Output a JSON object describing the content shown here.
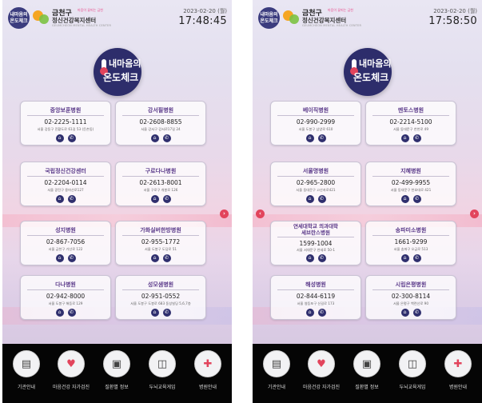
{
  "header": {
    "logo_badge": "내마음의 온도체크",
    "center_name": "금천구",
    "center_sub": "마음이 꽃피는 금천",
    "center_full": "정신건강복지센터",
    "center_eng": "GEUMCHEON MENTAL HEALTH CENTER"
  },
  "emblem": {
    "line1": "내마음의",
    "line2": "온도체크"
  },
  "screens": [
    {
      "date": "2023-02-20 (월)",
      "time": "17:48:45",
      "hospitals": [
        {
          "name": "중앙보훈병원",
          "phone": "02-2225-1111",
          "address": "서울 강동구 진황도로 61길 53 (둔촌동)"
        },
        {
          "name": "강서필병원",
          "phone": "02-2608-8855",
          "address": "서울 강서구 강서로17길 24"
        },
        {
          "name": "국립정신건강센터",
          "phone": "02-2204-0114",
          "address": "서울 광진구 용마산로127"
        },
        {
          "name": "구로다나병원",
          "phone": "02-2613-8001",
          "address": "서울 구로구 개봉로 126"
        },
        {
          "name": "성지병원",
          "phone": "02-867-7056",
          "address": "서울 금천구 가산로 122"
        },
        {
          "name": "가화실버한방병원",
          "phone": "02-955-1772",
          "address": "서울 도봉구 도당로 51"
        },
        {
          "name": "다나병원",
          "phone": "02-942-8000",
          "address": "서울 도봉구 해등로 129"
        },
        {
          "name": "성모샘병원",
          "phone": "02-951-0552",
          "address": "서울 도봉구 도봉로 683 동성빌딩 5,6,7층"
        }
      ]
    },
    {
      "date": "2023-02-20 (월)",
      "time": "17:58:50",
      "hospitals": [
        {
          "name": "베이직병원",
          "phone": "02-990-2999",
          "address": "서울 도봉구 삼양로 610"
        },
        {
          "name": "멘토스병원",
          "phone": "02-2214-5100",
          "address": "서울 동대문구 천천로 49"
        },
        {
          "name": "서울명병원",
          "phone": "02-965-2800",
          "address": "서울 동대문구 고산자로421"
        },
        {
          "name": "지혜병원",
          "phone": "02-499-9955",
          "address": "서울 동대문구 천호대로 421"
        },
        {
          "name": "연세대학교 의과대학 세브란스병원",
          "name1": "연세대학교 의과대학",
          "name2": "세브란스병원",
          "phone": "1599-1004",
          "address": "서울 서대문구 연세로 50-1"
        },
        {
          "name": "송파미소병원",
          "phone": "1661-9299",
          "address": "서울 송파구 오금로 513"
        },
        {
          "name": "해성병원",
          "phone": "02-844-6119",
          "address": "서울 영등포구 신길로 173"
        },
        {
          "name": "시립은평병원",
          "phone": "02-300-8114",
          "address": "서울 은평구 백련산로 90"
        }
      ]
    }
  ],
  "nav": [
    {
      "label": "기관안내",
      "icon": "book-icon"
    },
    {
      "label": "마음건강 자가검진",
      "icon": "heart-pulse-icon"
    },
    {
      "label": "질환별 정보",
      "icon": "clipboard-icon"
    },
    {
      "label": "두뇌교육게임",
      "icon": "gamepad-icon"
    },
    {
      "label": "병원안내",
      "icon": "hospital-icon"
    }
  ],
  "colors": {
    "navy": "#2f2f6e",
    "accent_red": "#e2445c",
    "hospital_name": "#5b3a8a",
    "bottom_bar": "#050505"
  }
}
